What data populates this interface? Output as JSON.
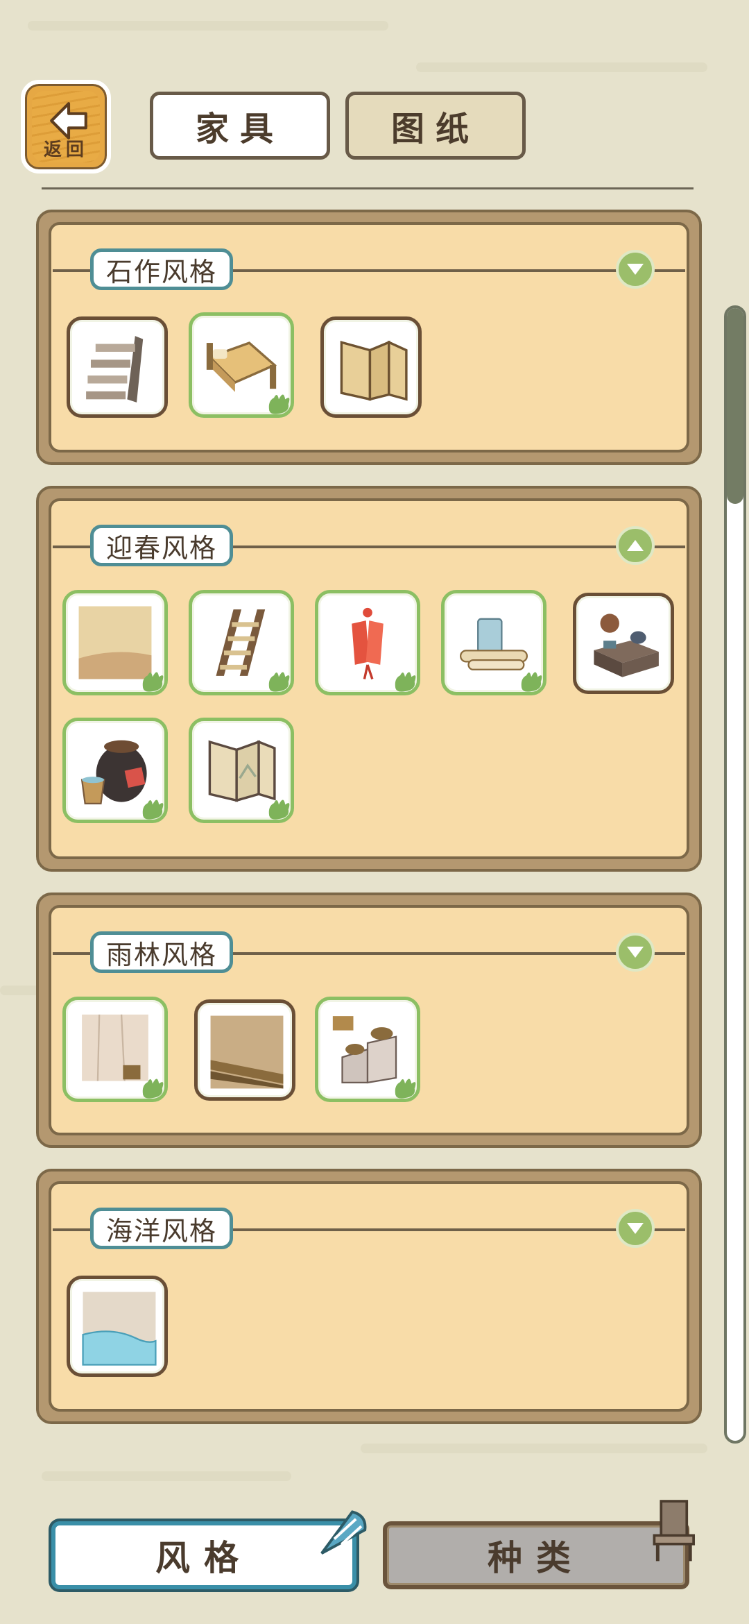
{
  "header": {
    "back_label": "返回",
    "tabs": [
      {
        "label": "家具",
        "active": true
      },
      {
        "label": "图纸",
        "active": false
      }
    ]
  },
  "sections": [
    {
      "title": "石作风格",
      "expanded": false,
      "toggle_icon": "chevron-down-icon",
      "items": [
        {
          "name": "stone-stairs",
          "collected": false
        },
        {
          "name": "stone-bed",
          "collected": true
        },
        {
          "name": "stone-folding-screen",
          "collected": false
        }
      ]
    },
    {
      "title": "迎春风格",
      "expanded": true,
      "toggle_icon": "chevron-up-icon",
      "items": [
        {
          "name": "spring-floor",
          "collected": true
        },
        {
          "name": "spring-ladder",
          "collected": true
        },
        {
          "name": "red-charm-tags",
          "collected": true
        },
        {
          "name": "cup-and-scrolls",
          "collected": true
        },
        {
          "name": "tea-stove-set",
          "collected": false
        },
        {
          "name": "jar-and-bucket",
          "collected": true
        },
        {
          "name": "landscape-screen",
          "collected": true
        }
      ]
    },
    {
      "title": "雨林风格",
      "expanded": false,
      "toggle_icon": "chevron-down-icon",
      "items": [
        {
          "name": "rainforest-wall",
          "collected": true
        },
        {
          "name": "rainforest-floor",
          "collected": false
        },
        {
          "name": "clay-oven",
          "collected": true
        }
      ]
    },
    {
      "title": "海洋风格",
      "expanded": false,
      "toggle_icon": "chevron-down-icon",
      "items": [
        {
          "name": "ocean-pool-floor",
          "collected": false
        }
      ]
    }
  ],
  "bottom_tabs": [
    {
      "label": "风格",
      "active": true,
      "icon": "shell-icon"
    },
    {
      "label": "种类",
      "active": false,
      "icon": "chair-icon"
    }
  ],
  "colors": {
    "background": "#e6e2cc",
    "panel": "#f8dca8",
    "panel_border": "#7c6848",
    "accent_teal": "#4f8e95",
    "collected_green": "#8cbf63",
    "back_button": "#e6a844"
  }
}
